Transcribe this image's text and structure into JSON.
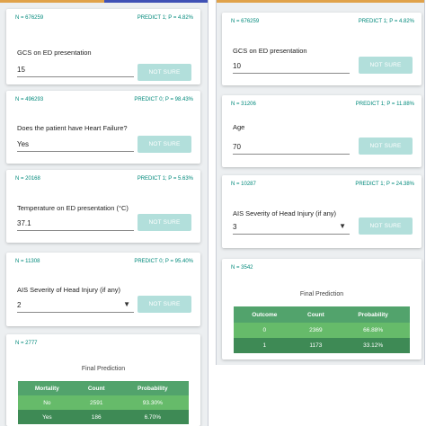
{
  "colors": {
    "accent": "#00897b",
    "button": "#b2dfdb",
    "table_header": "#52a36c",
    "table_row": "#66bb6a",
    "table_selected": "#3e8a55"
  },
  "left": {
    "cards": [
      {
        "n": "N = 676259",
        "predict": "PREDICT 1; P = 4.82%",
        "question": "GCS on ED presentation",
        "value": "15",
        "button": "NOT SURE"
      },
      {
        "n": "N = 496293",
        "predict": "PREDICT 0; P = 98.43%",
        "question": "Does the patient have Heart Failure?",
        "value": "Yes",
        "button": "NOT SURE"
      },
      {
        "n": "N = 20168",
        "predict": "PREDICT 1; P = 5.63%",
        "question": "Temperature on ED presentation (°C)",
        "value": "37.1",
        "button": "NOT SURE"
      },
      {
        "n": "N = 11308",
        "predict": "PREDICT 0; P = 95.40%",
        "question": "AIS Severity of Head Injury (if any)",
        "value": "2",
        "button": "NOT SURE"
      }
    ],
    "final": {
      "n": "N = 2777",
      "title": "Final Prediction",
      "headers": [
        "Mortality",
        "Count",
        "Probability"
      ],
      "rows": [
        [
          "No",
          "2591",
          "93.30%"
        ],
        [
          "Yes",
          "186",
          "6.70%"
        ]
      ]
    }
  },
  "right": {
    "cards": [
      {
        "n": "N = 676259",
        "predict": "PREDICT 1; P = 4.82%",
        "question": "GCS on ED presentation",
        "value": "10",
        "button": "NOT SURE"
      },
      {
        "n": "N = 31206",
        "predict": "PREDICT 1; P = 11.88%",
        "question": "Age",
        "value": "70",
        "button": "NOT SURE"
      },
      {
        "n": "N = 10287",
        "predict": "PREDICT 1; P = 24.38%",
        "question": "AIS Severity of Head Injury (if any)",
        "value": "3",
        "button": "NOT SURE"
      }
    ],
    "final": {
      "n": "N = 3542",
      "title": "Final Prediction",
      "headers": [
        "Outcome",
        "Count",
        "Probability"
      ],
      "rows": [
        [
          "0",
          "2369",
          "66.88%"
        ],
        [
          "1",
          "1173",
          "33.12%"
        ]
      ]
    }
  }
}
